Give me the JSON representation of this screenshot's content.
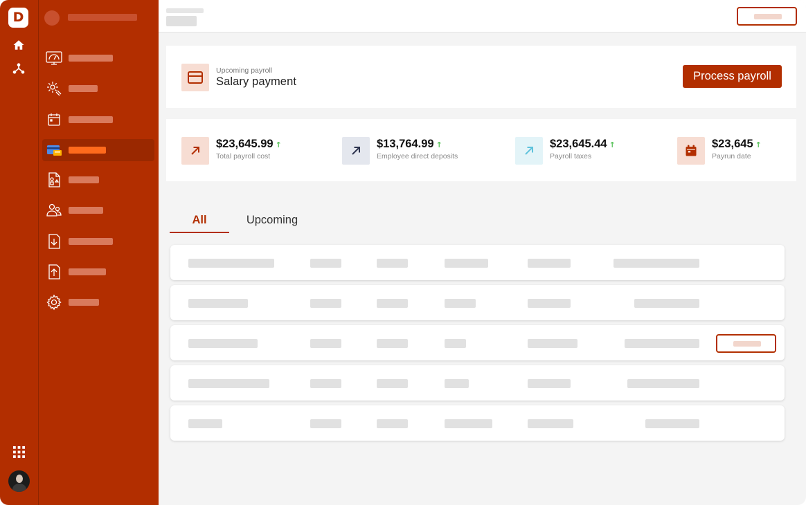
{
  "brand": {
    "logo_letter": "D",
    "accent": "#b22e00"
  },
  "rail": {
    "icons": [
      "home-icon",
      "network-icon",
      "apps-grid-icon"
    ]
  },
  "sidebar": {
    "items": [
      {
        "icon": "dashboard-icon",
        "active": false
      },
      {
        "icon": "settings-tools-icon",
        "active": false
      },
      {
        "icon": "calendar-icon",
        "active": false
      },
      {
        "icon": "payroll-card-icon",
        "active": true
      },
      {
        "icon": "documents-icon",
        "active": false
      },
      {
        "icon": "people-icon",
        "active": false
      },
      {
        "icon": "download-file-icon",
        "active": false
      },
      {
        "icon": "upload-file-icon",
        "active": false
      },
      {
        "icon": "gear-icon",
        "active": false
      }
    ]
  },
  "payroll": {
    "subtitle": "Upcoming payroll",
    "title": "Salary payment",
    "action_label": "Process payroll"
  },
  "stats": [
    {
      "value": "$23,645.99",
      "label": "Total payroll cost",
      "icon": "arrow-up-right-icon",
      "icon_color": "#b22e00",
      "bg": "#f7ddd3"
    },
    {
      "value": "$13,764.99",
      "label": "Employee direct deposits",
      "icon": "arrow-up-right-icon",
      "icon_color": "#2e3550",
      "bg": "#e4e7ee"
    },
    {
      "value": "$23,645.44",
      "label": "Payroll taxes",
      "icon": "arrow-up-right-icon",
      "icon_color": "#5ec2dc",
      "bg": "#e3f4f8"
    },
    {
      "value": "$23,645",
      "label": "Payrun date",
      "icon": "calendar-icon",
      "icon_color": "#b22e00",
      "bg": "#f7ddd3"
    }
  ],
  "tabs": [
    {
      "label": "All",
      "active": true
    },
    {
      "label": "Upcoming",
      "active": false
    }
  ]
}
